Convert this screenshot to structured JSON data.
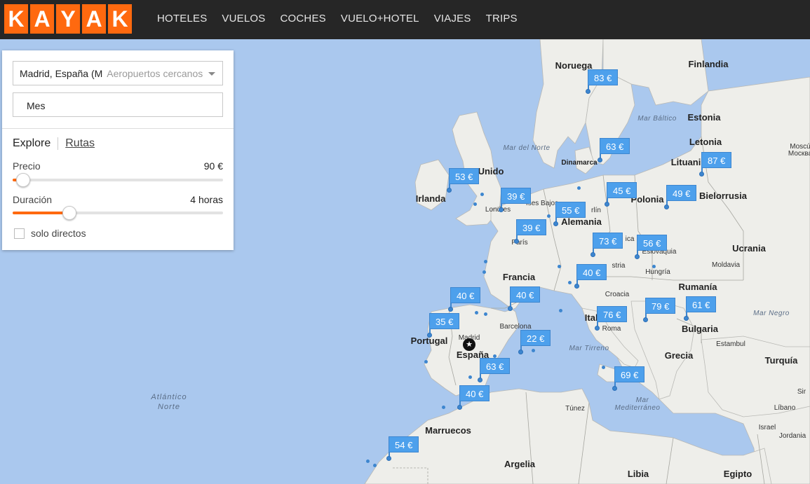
{
  "logo": {
    "letters": [
      "K",
      "A",
      "Y",
      "A",
      "K"
    ]
  },
  "nav": [
    "HOTELES",
    "VUELOS",
    "COCHES",
    "VUELO+HOTEL",
    "VIAJES",
    "TRIPS"
  ],
  "search": {
    "origin_value": "Madrid, España (M",
    "origin_placeholder": "Aeropuertos cercanos",
    "date_value": "Mes"
  },
  "tabs": {
    "explore": "Explore",
    "routes": "Rutas"
  },
  "filters": {
    "price_label": "Precio",
    "price_value": "90 €",
    "price_fraction": 0.05,
    "duration_label": "Duración",
    "duration_value": "4 horas",
    "duration_fraction": 0.27,
    "direct_label": "solo directos",
    "direct_checked": false
  },
  "map": {
    "labels": {
      "noruega": "Noruega",
      "finlandia": "Finlandia",
      "estonia": "Estonia",
      "letonia": "Letonia",
      "lituania": "Lituani",
      "bielorrusia": "Bielorrusia",
      "irlanda": "Irlanda",
      "reino_unido": "Unido",
      "polonia": "Polonia",
      "alemania": "Alemania",
      "francia": "Francia",
      "ucrania": "Ucrania",
      "moldavia": "Moldavia",
      "rumania": "Rumanía",
      "bulgaria": "Bulgaria",
      "grecia": "Grecia",
      "turquia": "Turquía",
      "portugal": "Portugal",
      "espana": "España",
      "marruecos": "Marruecos",
      "argelia": "Argelia",
      "libia": "Libia",
      "egipto": "Egipto",
      "tunez": "Túnez",
      "italia": "Itali",
      "austria": "stria",
      "hungria": "Hungría",
      "croacia": "Croacia",
      "eslovaquia": "Eslovaquia",
      "dinamarca": "Dinamarca",
      "mar_baltico": "Mar Báltico",
      "mar_norte": "Mar del Norte",
      "mar_negro": "Mar Negro",
      "mar_tirreno": "Mar Tirreno",
      "mar_med_1": "Mar",
      "mar_med_2": "Mediterráneo",
      "atlantico_1": "Atlántico",
      "atlantico_2": "Norte",
      "londres": "Londres",
      "paris": "París",
      "barcelona": "Barcelona",
      "madrid": "Madrid",
      "roma": "Roma",
      "estambul": "Estambul",
      "berlin": "rlín",
      "paises_bajos": "íses Bajos",
      "libano": "Líbano",
      "israel": "Israel",
      "jordania": "Jordania",
      "siria": "Sir",
      "moscu_1": "Moscú",
      "moscu_2": "Москва",
      "chequia": "ica"
    },
    "price_pins": [
      "83 €",
      "63 €",
      "87 €",
      "53 €",
      "39 €",
      "45 €",
      "49 €",
      "55 €",
      "39 €",
      "73 €",
      "56 €",
      "40 €",
      "40 €",
      "40 €",
      "35 €",
      "76 €",
      "79 €",
      "61 €",
      "22 €",
      "63 €",
      "69 €",
      "40 €",
      "54 €"
    ]
  },
  "colors": {
    "brand": "#ff690f",
    "topbar": "#262626",
    "pin": "#4da0ec",
    "sea": "#aac8ee",
    "land": "#eeeeea"
  }
}
